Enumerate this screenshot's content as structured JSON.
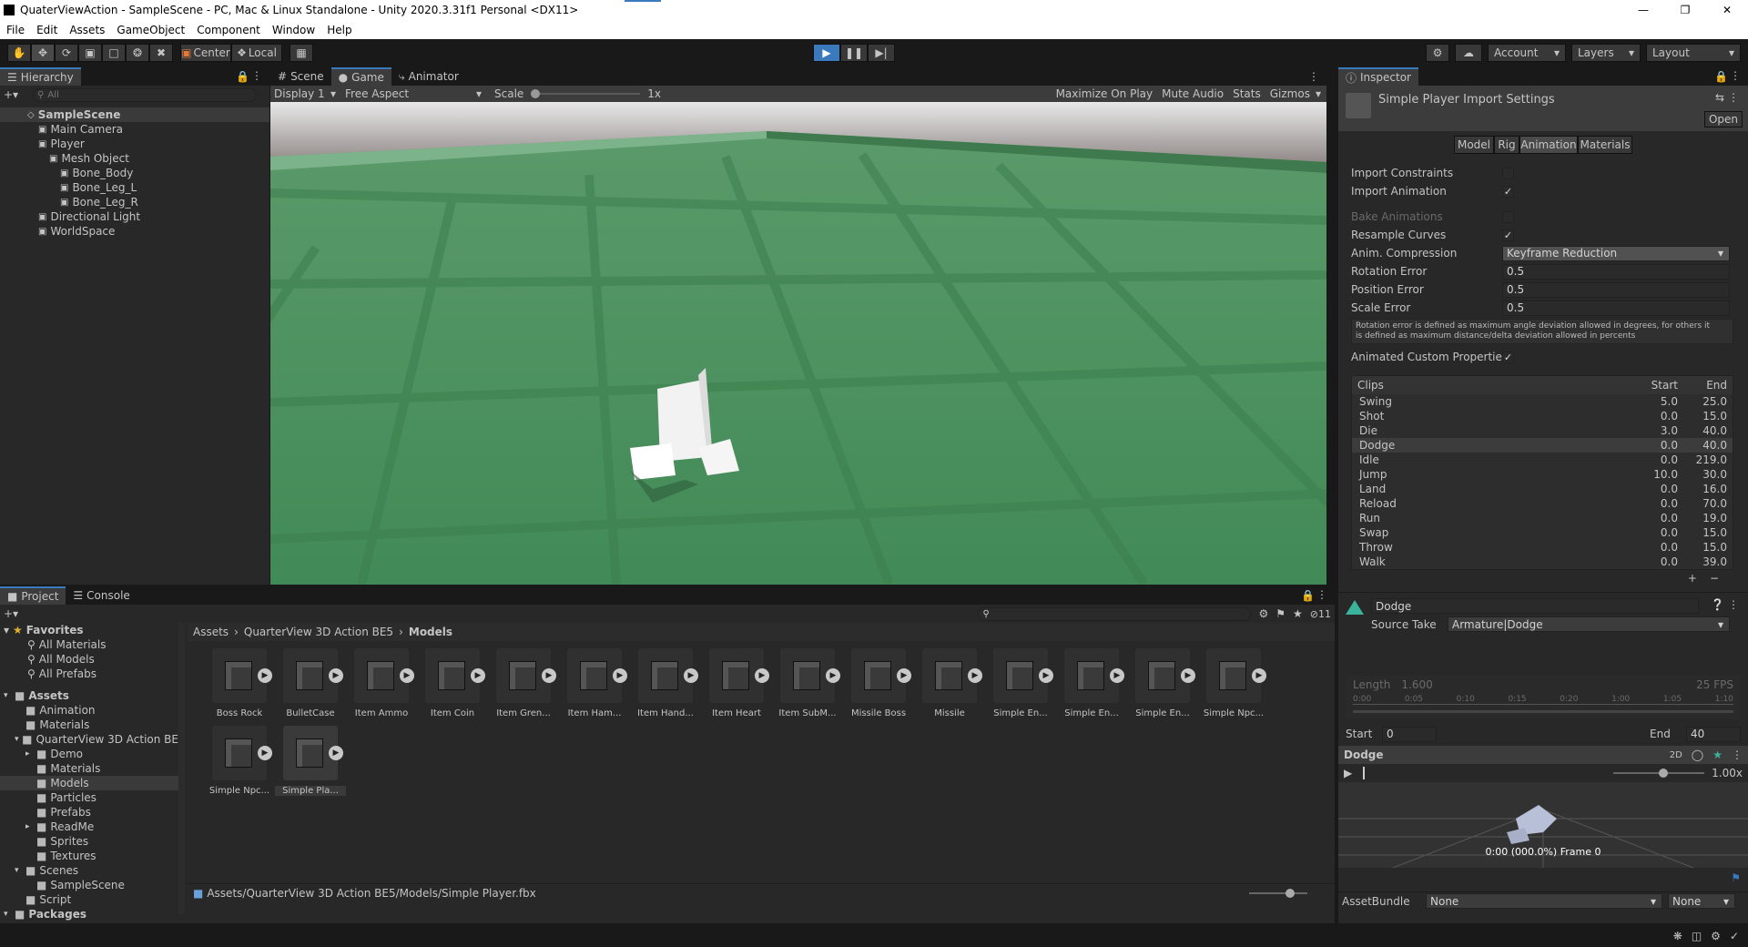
{
  "window": {
    "title": "QuaterViewAction - SampleScene - PC, Mac & Linux Standalone - Unity 2020.3.31f1 Personal <DX11>"
  },
  "menu": [
    "File",
    "Edit",
    "Assets",
    "GameObject",
    "Component",
    "Window",
    "Help"
  ],
  "toolbar": {
    "center": "Center",
    "local": "Local",
    "account": "Account",
    "layers": "Layers",
    "layout": "Layout"
  },
  "hierarchy": {
    "tab": "Hierarchy",
    "search_placeholder": "All",
    "items": [
      {
        "label": "SampleScene",
        "indent": 0
      },
      {
        "label": "Main Camera",
        "indent": 1
      },
      {
        "label": "Player",
        "indent": 1
      },
      {
        "label": "Mesh Object",
        "indent": 2
      },
      {
        "label": "Bone_Body",
        "indent": 3
      },
      {
        "label": "Bone_Leg_L",
        "indent": 3
      },
      {
        "label": "Bone_Leg_R",
        "indent": 3
      },
      {
        "label": "Directional Light",
        "indent": 1
      },
      {
        "label": "WorldSpace",
        "indent": 1
      }
    ]
  },
  "scene_tabs": [
    "Scene",
    "Game",
    "Animator"
  ],
  "game_bar": {
    "display": "Display 1",
    "aspect": "Free Aspect",
    "scale_label": "Scale",
    "scale_value": "1x",
    "maximize": "Maximize On Play",
    "mute": "Mute Audio",
    "stats": "Stats",
    "gizmos": "Gizmos"
  },
  "inspector": {
    "tab": "Inspector",
    "title": "Simple Player Import Settings",
    "open": "Open",
    "tabs": [
      "Model",
      "Rig",
      "Animation",
      "Materials"
    ],
    "import_constraints": "Import Constraints",
    "import_animation": "Import Animation",
    "bake_animations": "Bake Animations",
    "resample_curves": "Resample Curves",
    "anim_compression": "Anim. Compression",
    "anim_compression_value": "Keyframe Reduction",
    "rotation_error": "Rotation Error",
    "rotation_error_value": "0.5",
    "position_error": "Position Error",
    "position_error_value": "0.5",
    "scale_error": "Scale Error",
    "scale_error_value": "0.5",
    "help1": "Rotation error is defined as maximum angle deviation allowed in degrees, for others it",
    "help2": "is defined as maximum distance/delta deviation allowed in percents",
    "animated_custom": "Animated Custom Properties",
    "clips_header": {
      "name": "Clips",
      "start": "Start",
      "end": "End"
    },
    "clips": [
      {
        "name": "Swing",
        "start": "5.0",
        "end": "25.0"
      },
      {
        "name": "Shot",
        "start": "0.0",
        "end": "15.0"
      },
      {
        "name": "Die",
        "start": "3.0",
        "end": "40.0"
      },
      {
        "name": "Dodge",
        "start": "0.0",
        "end": "40.0"
      },
      {
        "name": "Idle",
        "start": "0.0",
        "end": "219.0"
      },
      {
        "name": "Jump",
        "start": "10.0",
        "end": "30.0"
      },
      {
        "name": "Land",
        "start": "0.0",
        "end": "16.0"
      },
      {
        "name": "Reload",
        "start": "0.0",
        "end": "70.0"
      },
      {
        "name": "Run",
        "start": "0.0",
        "end": "19.0"
      },
      {
        "name": "Swap",
        "start": "0.0",
        "end": "15.0"
      },
      {
        "name": "Throw",
        "start": "0.0",
        "end": "15.0"
      },
      {
        "name": "Walk",
        "start": "0.0",
        "end": "39.0"
      }
    ],
    "clip_name": "Dodge",
    "source_take_label": "Source Take",
    "source_take": "Armature|Dodge",
    "length_label": "Length",
    "length": "1.600",
    "fps": "25 FPS",
    "timeline_ticks": [
      "0:00",
      "0:05",
      "0:10",
      "0:15",
      "0:20",
      "1:00",
      "1:05",
      "1:10"
    ],
    "start_label": "Start",
    "start_value": "0",
    "end_label": "End",
    "end_value": "40",
    "preview_name": "Dodge",
    "preview_2d": "2D",
    "speed": "1.00x",
    "frame": "0:00 (000.0%) Frame 0",
    "assetbundle_label": "AssetBundle",
    "assetbundle": "None",
    "variant": "None"
  },
  "project": {
    "tabs": [
      "Project",
      "Console"
    ],
    "count": "11",
    "favorites": {
      "label": "Favorites",
      "items": [
        "All Materials",
        "All Models",
        "All Prefabs"
      ]
    },
    "tree": [
      {
        "label": "Assets",
        "indent": 0,
        "bold": true
      },
      {
        "label": "Animation",
        "indent": 1
      },
      {
        "label": "Materials",
        "indent": 1
      },
      {
        "label": "QuarterView 3D Action BE",
        "indent": 1
      },
      {
        "label": "Demo",
        "indent": 2
      },
      {
        "label": "Materials",
        "indent": 2
      },
      {
        "label": "Models",
        "indent": 2
      },
      {
        "label": "Particles",
        "indent": 2
      },
      {
        "label": "Prefabs",
        "indent": 2
      },
      {
        "label": "ReadMe",
        "indent": 2
      },
      {
        "label": "Sprites",
        "indent": 2
      },
      {
        "label": "Textures",
        "indent": 2
      },
      {
        "label": "Scenes",
        "indent": 1
      },
      {
        "label": "SampleScene",
        "indent": 2
      },
      {
        "label": "Script",
        "indent": 1
      },
      {
        "label": "Packages",
        "indent": 0,
        "bold": true
      }
    ],
    "breadcrumb": [
      "Assets",
      "QuarterView 3D Action BE5",
      "Models"
    ],
    "assets": [
      "Boss Rock",
      "BulletCase",
      "Item Ammo",
      "Item Coin",
      "Item Gren...",
      "Item Ham...",
      "Item Hand...",
      "Item Heart",
      "Item SubM...",
      "Missile Boss",
      "Missile",
      "Simple En...",
      "Simple En...",
      "Simple En...",
      "Simple Npc...",
      "Simple Npc...",
      "Simple Pla..."
    ],
    "path": "Assets/QuarterView 3D Action BE5/Models/Simple Player.fbx"
  }
}
